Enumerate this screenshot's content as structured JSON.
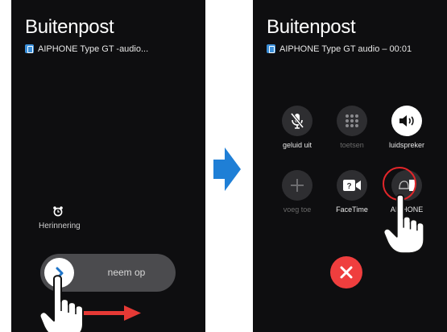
{
  "left_screen": {
    "caller_name": "Buitenpost",
    "subtitle": "AIPHONE Type GT -audio...",
    "reminder_label": "Herinnering",
    "slider_label": "neem op"
  },
  "right_screen": {
    "caller_name": "Buitenpost",
    "subtitle": "AIPHONE Type GT  audio – 00:01",
    "buttons": [
      {
        "label": "geluid uit",
        "icon": "mic-slash-icon"
      },
      {
        "label": "toetsen",
        "icon": "keypad-icon"
      },
      {
        "label": "luidspreker",
        "icon": "speaker-icon"
      },
      {
        "label": "voeg toe",
        "icon": "plus-icon"
      },
      {
        "label": "FaceTime",
        "icon": "facetime-icon"
      },
      {
        "label": "AIPHONE",
        "icon": "aiphone-door-icon"
      }
    ],
    "end_call_icon": "close-icon"
  },
  "colors": {
    "screen_bg": "#0e0e10",
    "slider_bg": "#4b4b4e",
    "end_call": "#ef3e3e",
    "highlight_ring": "#e2262a",
    "swipe_arrow": "#e53935",
    "transition_arrow": "#1f7fd6",
    "app_badge": "#3b8fd9"
  }
}
